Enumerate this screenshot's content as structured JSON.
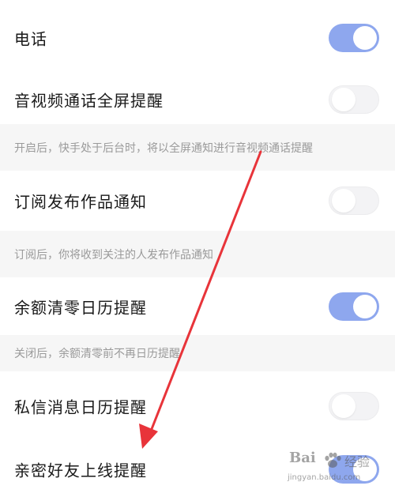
{
  "settings": [
    {
      "label": "电话",
      "enabled": true
    },
    {
      "label": "音视频通话全屏提醒",
      "enabled": false,
      "description": "开启后，快手处于后台时，将以全屏通知进行音视频通话提醒"
    },
    {
      "label": "订阅发布作品通知",
      "enabled": false,
      "description": "订阅后，你将收到关注的人发布作品通知"
    },
    {
      "label": "余额清零日历提醒",
      "enabled": true,
      "description": "关闭后，余额清零前不再日历提醒"
    },
    {
      "label": "私信消息日历提醒",
      "enabled": false
    },
    {
      "label": "亲密好友上线提醒",
      "enabled": true
    }
  ],
  "colors": {
    "toggle_on": "#8ea7ee",
    "toggle_off": "#f3f3f5",
    "annotation_arrow": "#e8343a"
  },
  "watermark": {
    "brand": "Bai",
    "brand_cn": "经验",
    "url": "jingyan.baidu.com"
  }
}
